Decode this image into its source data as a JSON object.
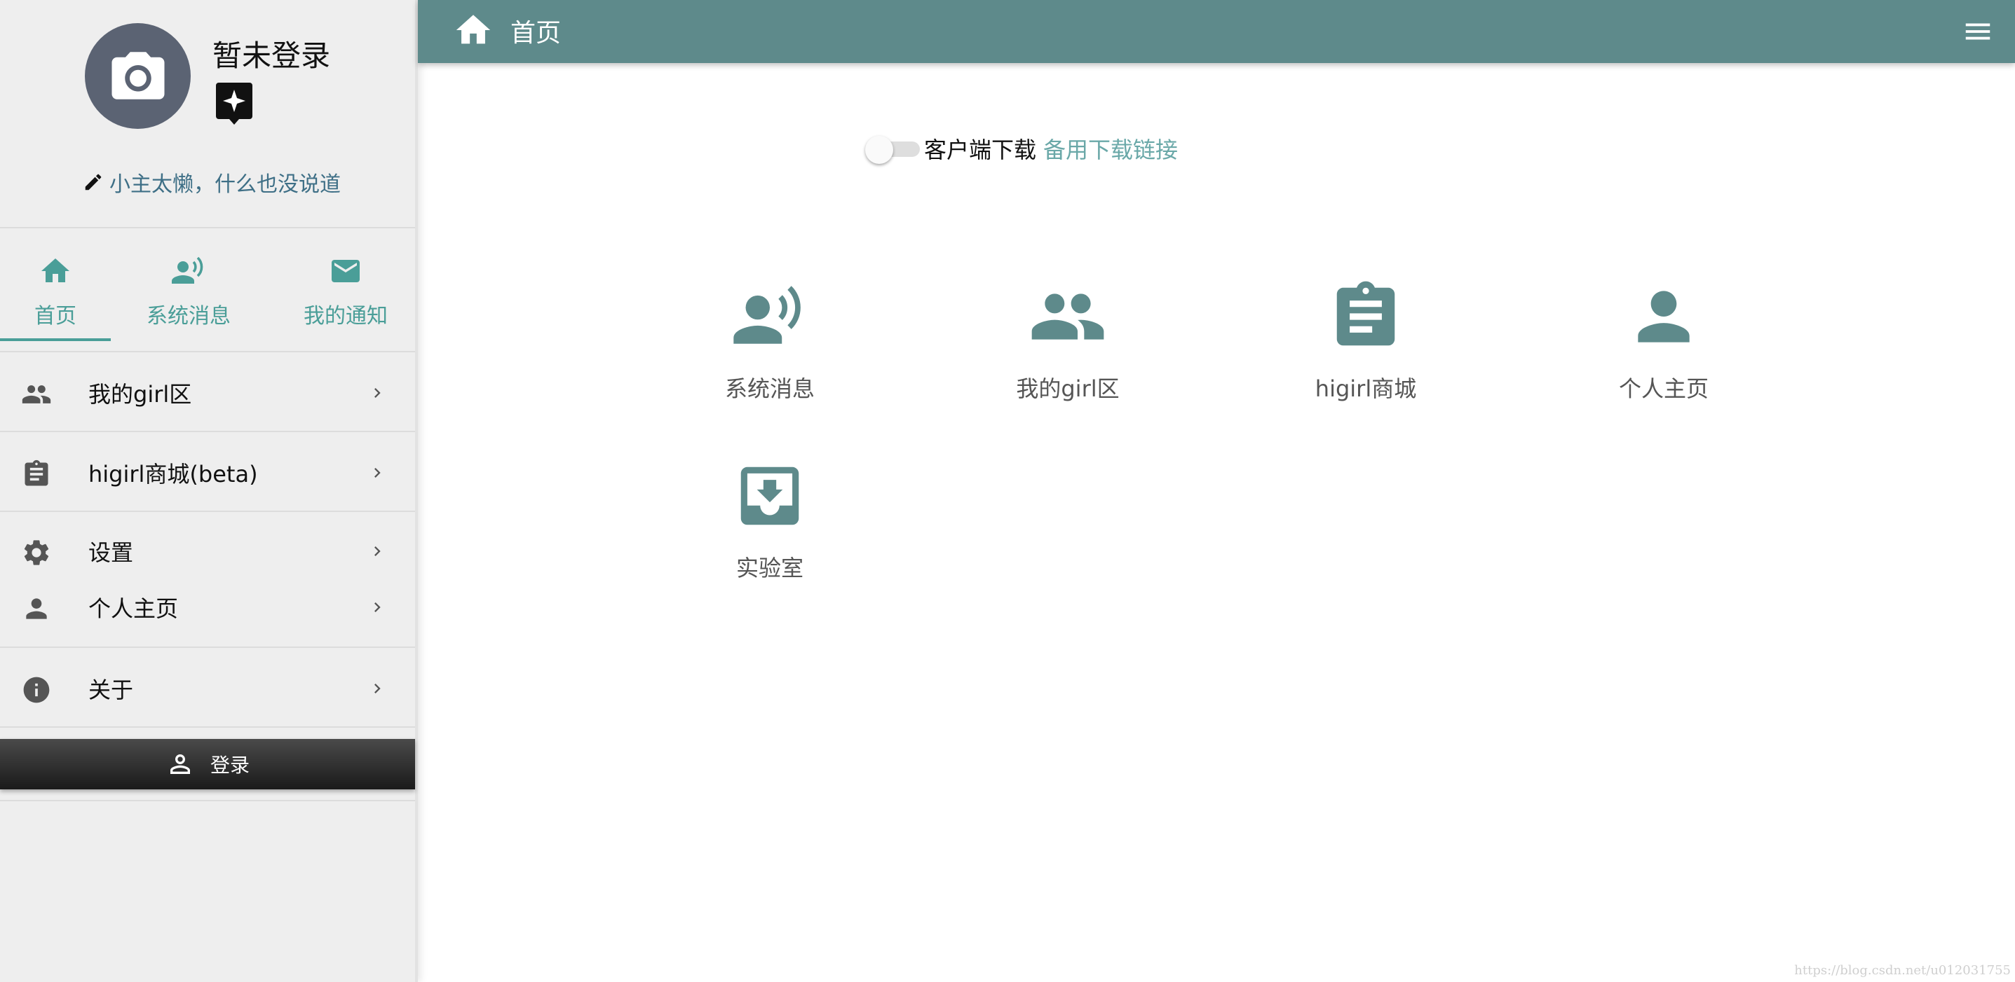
{
  "colors": {
    "header_bg": "#5e8a8b",
    "accent": "#4a9e98",
    "icon_teal": "#5e8a8b",
    "sidebar_bg": "#eeeeee",
    "avatar_bg": "#5b6373",
    "link": "#6aa8a8"
  },
  "sidebar": {
    "profile": {
      "username": "暂未登录",
      "avatar_icon": "camera-icon",
      "badge_icon": "sparkle-badge-icon",
      "motto": "小主太懒，什么也没说道"
    },
    "tabs": [
      {
        "label": "首页",
        "icon": "home-icon",
        "active": true
      },
      {
        "label": "系统消息",
        "icon": "speaker-person-icon",
        "active": false
      },
      {
        "label": "我的通知",
        "icon": "mail-icon",
        "active": false
      }
    ],
    "menu": [
      {
        "label": "我的girl区",
        "icon": "people-icon"
      },
      {
        "label": "higirl商城(beta)",
        "icon": "clipboard-icon"
      },
      {
        "label": "设置",
        "icon": "gear-icon"
      },
      {
        "label": "个人主页",
        "icon": "person-icon"
      },
      {
        "label": "关于",
        "icon": "info-icon"
      }
    ],
    "login_label": "登录"
  },
  "header": {
    "title": "首页",
    "icon": "home-icon",
    "menu_icon": "hamburger-menu-icon"
  },
  "main": {
    "download": {
      "label": "客户端下载",
      "link": "备用下载链接",
      "switch_on": false
    },
    "apps": [
      {
        "label": "系统消息",
        "icon": "speaker-person-icon"
      },
      {
        "label": "我的girl区",
        "icon": "people-icon"
      },
      {
        "label": "higirl商城",
        "icon": "clipboard-icon"
      },
      {
        "label": "个人主页",
        "icon": "person-icon"
      },
      {
        "label": "实验室",
        "icon": "inbox-download-icon"
      }
    ]
  },
  "watermark": "https://blog.csdn.net/u012031755"
}
